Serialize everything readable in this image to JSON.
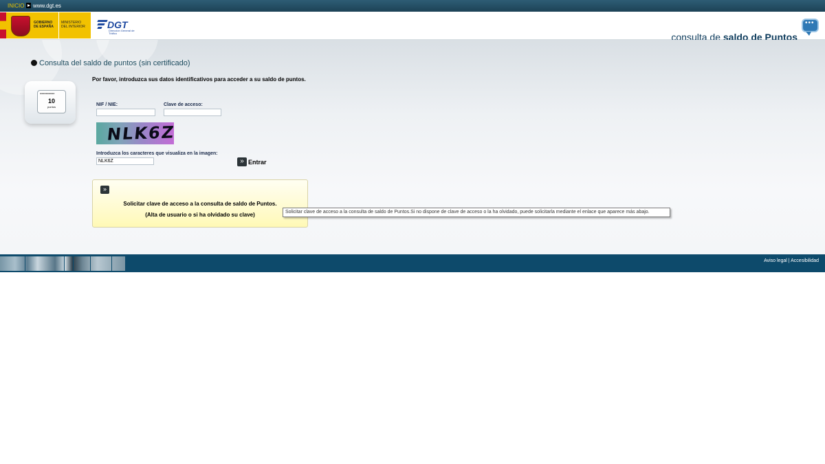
{
  "topbar": {
    "inicio": "INICIO",
    "url": "www.dgt.es"
  },
  "header": {
    "gobierno": "GOBIERNO DE ESPAÑA",
    "ministerio": "MINISTERIO DEL INTERIOR",
    "dgt_logo": "DGT",
    "dgt_sub": "Dirección General de Tráfico",
    "title_prefix": "consulta de",
    "title_bold": "saldo de Puntos",
    "icon": "chat-bubble-icon"
  },
  "main": {
    "section_title": "Consulta del saldo de puntos (sin certificado)",
    "card_number": "10",
    "card_label": "puntos",
    "card_icon": "points-card-icon",
    "intro": "Por favor, introduzca sus datos identificativos para acceder a su saldo de puntos.",
    "nif_label": "NIF / NIE:",
    "nif_value": "",
    "clave_label": "Clave de acceso:",
    "clave_value": "",
    "captcha_text": "NLK6Z",
    "captcha_label": "Introduzca los caracteres que visualiza en la imagen:",
    "captcha_value": "NLK6Z",
    "entrar_label": "Entrar",
    "request_line1": "Solicitar clave de acceso a la consulta de saldo de Puntos.",
    "request_line2": "(Alta de usuario o si ha olvidado su clave)",
    "tooltip": "Solicitar clave de acceso a la consulta de saldo de Puntos.Si no dispone de clave de acceso o la ha olvidado, puede solicitarla mediante el enlace que aparece más abajo."
  },
  "footer": {
    "aviso_legal": "Aviso legal",
    "separator": "|",
    "accesibilidad": "Accesibilidad"
  },
  "colors": {
    "topbar": "#1c4256",
    "footer": "#0d4a6b",
    "title": "#0d3b5c",
    "highlight_box": "#fffbd0",
    "inicio_text": "#e8c400"
  }
}
